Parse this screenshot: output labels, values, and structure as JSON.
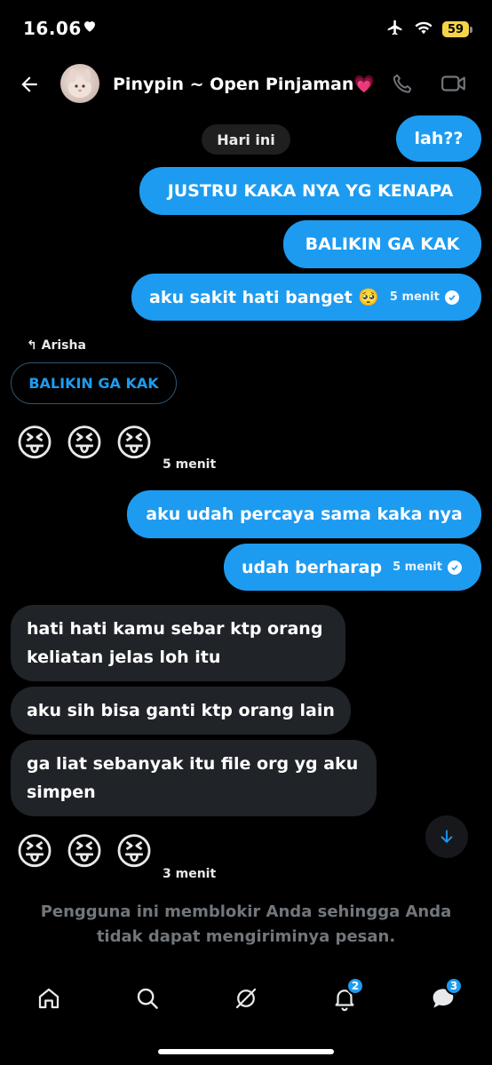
{
  "status_bar": {
    "time": "16.06",
    "battery": "59"
  },
  "header": {
    "title": "Pinypin ~ Open Pinjaman💗",
    "icons": [
      "back-arrow-icon",
      "phone-icon",
      "video-icon"
    ]
  },
  "chat": {
    "date_label": "Hari ini",
    "outgoing_top": [
      {
        "text": "lah??"
      },
      {
        "text": "JUSTRU KAKA NYA YG KENAPA"
      },
      {
        "text": "BALIKIN GA KAK"
      },
      {
        "text": "aku sakit hati banget 🥺",
        "time": "5 menit"
      }
    ],
    "reply": {
      "to": "Arisha",
      "quoted_text": "BALIKIN GA KAK"
    },
    "emoji_group_1": {
      "emojis": [
        "😝",
        "😝",
        "😝"
      ],
      "time": "5 menit"
    },
    "outgoing_middle": [
      {
        "text": "aku udah percaya sama kaka nya"
      },
      {
        "text": "udah berharap",
        "time": "5 menit"
      }
    ],
    "incoming": [
      {
        "text": "hati hati kamu sebar ktp orang keliatan jelas loh itu"
      },
      {
        "text": "aku sih bisa ganti ktp orang lain"
      },
      {
        "text": "ga liat sebanyak itu file org yg aku simpen"
      }
    ],
    "emoji_group_2": {
      "emojis": [
        "😝",
        "😝",
        "😝"
      ],
      "time": "3 menit"
    }
  },
  "blocked_notice": "Pengguna ini memblokir Anda sehingga Anda tidak dapat mengiriminya pesan.",
  "bottom_nav": {
    "items": [
      "home-icon",
      "search-icon",
      "grok-icon",
      "bell-icon",
      "messages-icon"
    ],
    "notifications_badge": "2",
    "messages_badge": "3"
  },
  "colors": {
    "accent": "#1d9bf0",
    "incoming_bubble": "#202327",
    "background": "#000000",
    "muted_text": "#71767b"
  }
}
